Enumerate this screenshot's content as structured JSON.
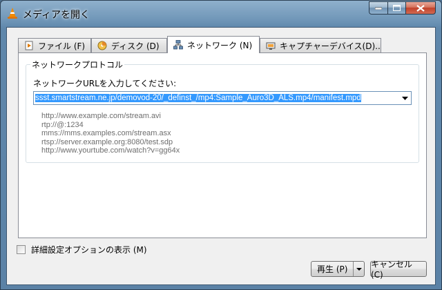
{
  "window": {
    "title": "メディアを開く",
    "icon": "vlc-cone-icon"
  },
  "tabs": [
    {
      "label": "ファイル (F)",
      "icon": "file-play-icon",
      "active": false
    },
    {
      "label": "ディスク (D)",
      "icon": "disc-icon",
      "active": false
    },
    {
      "label": "ネットワーク (N)",
      "icon": "network-icon",
      "active": true
    },
    {
      "label": "キャプチャーデバイス(D)...",
      "icon": "capture-device-icon",
      "active": false
    }
  ],
  "network": {
    "group_title": "ネットワークプロトコル",
    "url_label": "ネットワークURLを入力してください:",
    "url_value": "ssst.smartstream.ne.jp/demovod-20/_definst_/mp4:Sample_Auro3D_ALS.mp4/manifest.mpd",
    "examples": [
      "http://www.example.com/stream.avi",
      "rtp://@:1234",
      "mms://mms.examples.com/stream.asx",
      "rtsp://server.example.org:8080/test.sdp",
      "http://www.yourtube.com/watch?v=gg64x"
    ]
  },
  "advanced_options": {
    "label": "詳細設定オプションの表示 (M)",
    "checked": false
  },
  "buttons": {
    "play": "再生 (P)",
    "cancel": "キャンセル (C)"
  },
  "colors": {
    "selection": "#3399ff",
    "hint_text": "#6d6d6d"
  }
}
